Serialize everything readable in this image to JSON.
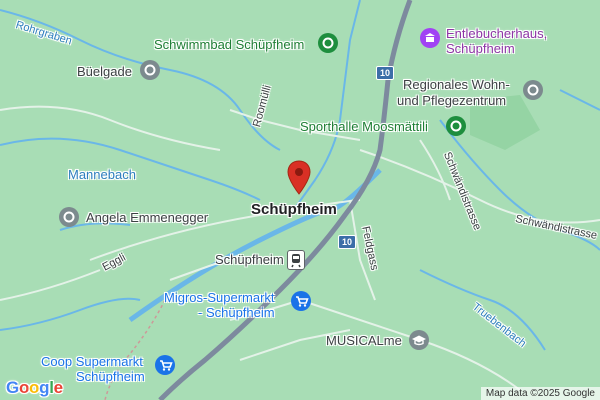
{
  "map": {
    "town_label": "Schüpfheim",
    "pois": {
      "schwimmbad": "Schwimmbad Schüpfheim",
      "entlebucherhaus_1": "Entlebucherhaus,",
      "entlebucherhaus_2": "Schüpfheim",
      "buelgade": "Büelgade",
      "regionales_1": "Regionales Wohn-",
      "regionales_2": "und Pflegezentrum",
      "sporthalle": "Sporthalle Moosmättili",
      "angela": "Angela Emmenegger",
      "station": "Schüpfheim",
      "migros_1": "Migros-Supermarkt",
      "migros_2": "- Schüpfheim",
      "musicalme": "MUSICALme",
      "coop_1": "Coop Supermarkt",
      "coop_2": "Schüpfheim"
    },
    "water": {
      "rohrgraben": "Rohrgraben",
      "mannebach": "Mannebach",
      "truebenbach": "Truebenbach"
    },
    "streets": {
      "roomuli": "Roomülli",
      "schwaendistrasse_1": "Schwändistrasse",
      "schwaendistrasse_2": "Schwändistrasse",
      "eggli": "Eggli",
      "feldgass": "Feldgass"
    },
    "road_shields": [
      "10",
      "10"
    ],
    "icons": {
      "schwimmbad": "park-icon",
      "entlebucherhaus": "museum-icon",
      "buelgade": "place-icon",
      "regionales": "place-icon",
      "sporthalle": "sports-icon",
      "angela": "place-icon",
      "station": "train-station-icon",
      "migros": "shopping-cart-icon",
      "musicalme": "school-icon",
      "coop": "shopping-cart-icon",
      "marker": "location-marker-icon"
    },
    "colors": {
      "land": "#a8ddb5",
      "water": "#6ab7e8",
      "highway": "#7d8a9e",
      "marker": "#d93025",
      "green_poi": "#1e8e3e",
      "purple_poi": "#a142f4",
      "blue_poi": "#1a73e8",
      "grey_poi": "#7c8a8e"
    }
  },
  "branding": {
    "logo_letters": [
      "G",
      "o",
      "o",
      "g",
      "l",
      "e"
    ],
    "attribution": "Map data ©2025 Google"
  }
}
